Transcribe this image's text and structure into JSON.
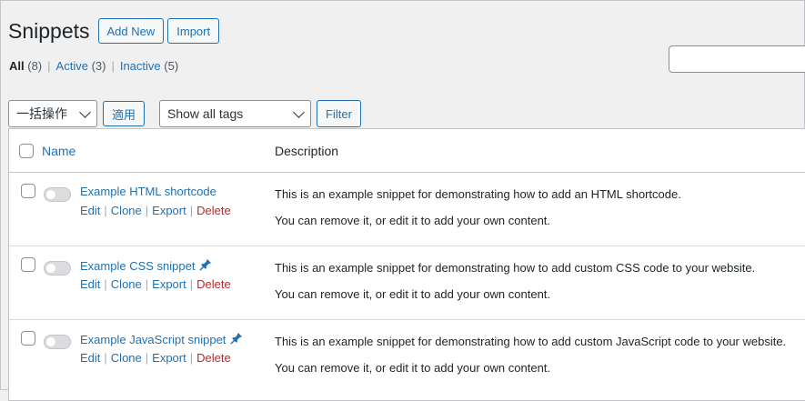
{
  "page": {
    "title": "Snippets",
    "add_new_label": "Add New",
    "import_label": "Import"
  },
  "filters": {
    "all": {
      "label": "All",
      "count": "(8)"
    },
    "active": {
      "label": "Active",
      "count": "(3)"
    },
    "inactive": {
      "label": "Inactive",
      "count": "(5)"
    },
    "separator": "|"
  },
  "search": {
    "value": ""
  },
  "tablenav": {
    "bulk_action_selected": "一括操作",
    "apply_label": "適用",
    "tags_selected": "Show all tags",
    "filter_label": "Filter"
  },
  "table": {
    "columns": {
      "name": "Name",
      "description": "Description"
    },
    "rows": [
      {
        "name": "Example HTML shortcode",
        "pinned": false,
        "active": false,
        "actions": [
          "Edit",
          "Clone",
          "Export",
          "Delete"
        ],
        "description_line1": "This is an example snippet for demonstrating how to add an HTML shortcode.",
        "description_line2": "You can remove it, or edit it to add your own content."
      },
      {
        "name": "Example CSS snippet",
        "pinned": true,
        "active": false,
        "actions": [
          "Edit",
          "Clone",
          "Export",
          "Delete"
        ],
        "description_line1": "This is an example snippet for demonstrating how to add custom CSS code to your website.",
        "description_line2": "You can remove it, or edit it to add your own content."
      },
      {
        "name": "Example JavaScript snippet",
        "pinned": true,
        "active": false,
        "actions": [
          "Edit",
          "Clone",
          "Export",
          "Delete"
        ],
        "description_line1": "This is an example snippet for demonstrating how to add custom JavaScript code to your website.",
        "description_line2": "You can remove it, or edit it to add your own content."
      }
    ]
  },
  "icons": {
    "pin": "pin-icon",
    "chevron": "chevron-down-icon"
  },
  "colors": {
    "link": "#2271b1",
    "delete": "#b32d2e",
    "background": "#f0f0f1"
  }
}
